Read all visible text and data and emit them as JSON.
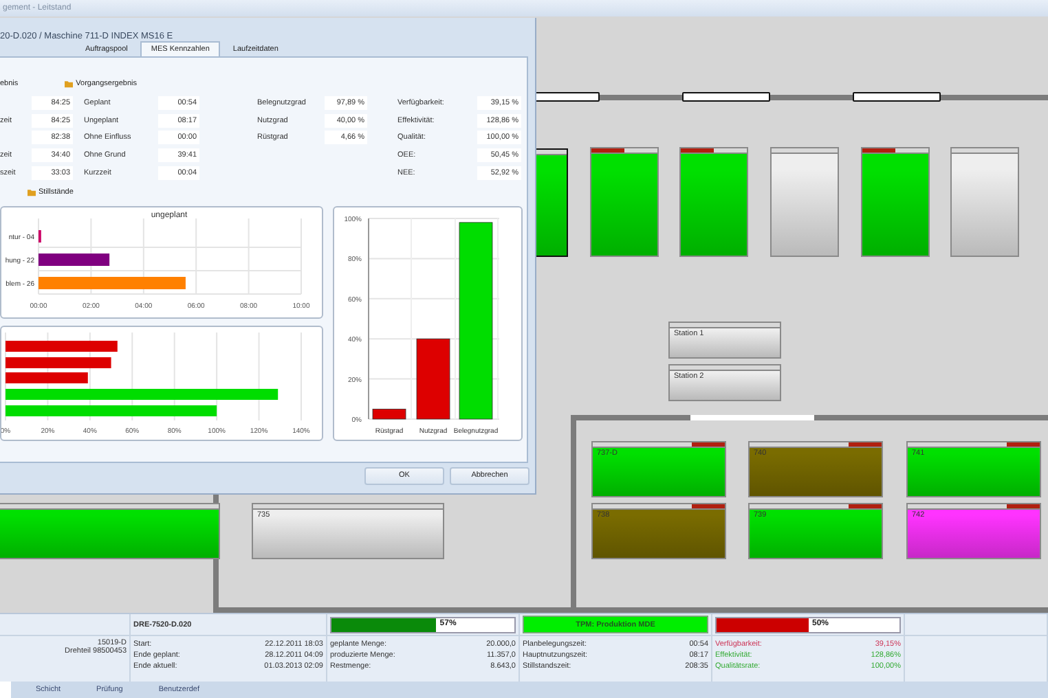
{
  "window": {
    "title": "gement - Leitstand"
  },
  "machines": [
    {
      "color": "#00e000",
      "alarm": false,
      "selected": true
    },
    {
      "color": "#00e000",
      "alarm": true,
      "selected": false
    },
    {
      "color": "#00e000",
      "alarm": true,
      "selected": false
    },
    {
      "color": "#eeeeee",
      "alarm": false,
      "selected": false
    },
    {
      "color": "#00e000",
      "alarm": true,
      "selected": false
    },
    {
      "color": "#eeeeee",
      "alarm": false,
      "selected": false
    },
    {
      "label": "Station 1",
      "color": "#eeeeee",
      "alarm": false,
      "selected": false
    },
    {
      "label": "Station 2",
      "color": "#eeeeee",
      "alarm": false,
      "selected": false
    },
    {
      "label": "737-D",
      "color": "#00e000",
      "alarm": true,
      "selected": false
    },
    {
      "label": "740",
      "color": "#7a6c00",
      "alarm": true,
      "selected": false
    },
    {
      "label": "741",
      "color": "#00e000",
      "alarm": true,
      "selected": false
    },
    {
      "color": "#00e000",
      "alarm": false,
      "selected": false
    },
    {
      "label": "735",
      "color": "#eeeeee",
      "alarm": false,
      "selected": false
    },
    {
      "label": "738",
      "color": "#7a6c00",
      "alarm": true,
      "selected": false
    },
    {
      "label": "739",
      "color": "#00e000",
      "alarm": true,
      "selected": false
    },
    {
      "label": "742",
      "color": "#ff33ff",
      "alarm": true,
      "selected": false
    }
  ],
  "dialog": {
    "title": "20-D.020 / Maschine 711-D INDEX MS16 E",
    "tabs": [
      {
        "label": "Auftragspool",
        "selected": false
      },
      {
        "label": "MES Kennzahlen",
        "selected": true
      },
      {
        "label": "Laufzeitdaten",
        "selected": false
      }
    ],
    "headers": [
      "ebnis",
      "Vorgangsergebnis"
    ],
    "metric_columns": [
      [
        {
          "value": "84:25"
        },
        {
          "label": "zeit",
          "value": "84:25"
        },
        {
          "value": "82:38"
        },
        {
          "label": "zeit",
          "value": "34:40"
        },
        {
          "label": "szeit",
          "value": "33:03"
        }
      ],
      [
        {
          "label": "Geplant",
          "value": "00:54"
        },
        {
          "label": "Ungeplant",
          "value": "08:17"
        },
        {
          "label": "Ohne Einfluss",
          "value": "00:00"
        },
        {
          "label": "Ohne Grund",
          "value": "39:41"
        },
        {
          "label": "Kurzzeit",
          "value": "00:04"
        }
      ],
      [
        {
          "label": "Belegnutzgrad",
          "value": "97,89 %"
        },
        {
          "label": "Nutzgrad",
          "value": "40,00 %"
        },
        {
          "label": "Rüstgrad",
          "value": "4,66 %"
        }
      ],
      [
        {
          "label": "Verfügbarkeit:",
          "value": "39,15 %"
        },
        {
          "label": "Effektivität:",
          "value": "128,86 %"
        },
        {
          "label": "Qualität:",
          "value": "100,00 %"
        },
        {
          "label": "OEE:",
          "value": "50,45 %"
        },
        {
          "label": "NEE:",
          "value": "52,92 %"
        }
      ]
    ],
    "stops_header": "Stillstände",
    "chart_stops": {
      "chart_data": {
        "type": "bar",
        "orientation": "horizontal",
        "stacked": true,
        "grid": true,
        "title": "ungeplant",
        "categories": [
          "ntur - 04",
          "hung - 22",
          "blem - 26"
        ],
        "series": [
          {
            "color": "#cc0066",
            "values": [
              0.1,
              null,
              null
            ]
          },
          {
            "color": "#800080",
            "values": [
              null,
              2.7,
              null
            ]
          },
          {
            "color": "#ff8000",
            "values": [
              null,
              null,
              5.6
            ]
          }
        ],
        "xlim": [
          0,
          10
        ],
        "xticks": [
          {
            "value": 0,
            "label": "00:00"
          },
          {
            "value": 2,
            "label": "02:00"
          },
          {
            "value": 4,
            "label": "04:00"
          },
          {
            "value": 6,
            "label": "06:00"
          },
          {
            "value": 8,
            "label": "08:00"
          },
          {
            "value": 10,
            "label": "10:00"
          }
        ]
      }
    },
    "chart_kpi": {
      "chart_data": {
        "type": "bar",
        "orientation": "horizontal",
        "stacked": true,
        "grid": true,
        "xlim": [
          0,
          140
        ],
        "series": [
          {
            "color": "#dd0000",
            "values": [
              53,
              50,
              39,
              null,
              null
            ]
          },
          {
            "color": "#00dd00",
            "values": [
              null,
              null,
              null,
              129,
              100
            ]
          }
        ],
        "xticks": [
          {
            "value": 0,
            "label": "0%"
          },
          {
            "value": 20,
            "label": "20%"
          },
          {
            "value": 40,
            "label": "40%"
          },
          {
            "value": 60,
            "label": "60%"
          },
          {
            "value": 80,
            "label": "80%"
          },
          {
            "value": 100,
            "label": "100%"
          },
          {
            "value": 120,
            "label": "120%"
          },
          {
            "value": 140,
            "label": "140%"
          }
        ]
      }
    },
    "chart_grades": {
      "chart_data": {
        "type": "bar",
        "orientation": "vertical",
        "stacked": true,
        "grid": true,
        "categories": [
          "Rüstgrad",
          "Nutzgrad",
          "Belegnutzgrad"
        ],
        "ylim": [
          0,
          100
        ],
        "series": [
          {
            "color": "#dd0000",
            "values": [
              5,
              40,
              null
            ]
          },
          {
            "color": "#00dd00",
            "values": [
              null,
              null,
              98
            ]
          }
        ],
        "yticks": [
          {
            "value": 0,
            "label": "0%"
          },
          {
            "value": 20,
            "label": "20%"
          },
          {
            "value": 40,
            "label": "40%"
          },
          {
            "value": 60,
            "label": "60%"
          },
          {
            "value": 80,
            "label": "80%"
          },
          {
            "value": 100,
            "label": "100%"
          }
        ]
      }
    },
    "buttons": [
      "OK",
      "Abbrechen"
    ]
  },
  "info": {
    "order": "DRE-7520-D.020",
    "article_no": "15019-D",
    "article": "Drehteil 98500453",
    "progress": [
      {
        "text": "57%",
        "level": 0.57,
        "color": "#0a8a0a"
      },
      {
        "text": "50%",
        "level": 0.5,
        "color": "#cc0000"
      }
    ],
    "status": "TPM: Produktion MDE",
    "dates": [
      {
        "label": "Start:",
        "value": "22.12.2011 18:03"
      },
      {
        "label": "Ende geplant:",
        "value": "28.12.2011 04:09"
      },
      {
        "label": "Ende aktuell:",
        "value": "01.03.2013 02:09"
      }
    ],
    "quantities": [
      {
        "label": "geplante Menge:",
        "value": "20.000,0"
      },
      {
        "label": "produzierte Menge:",
        "value": "11.357,0"
      },
      {
        "label": "Restmenge:",
        "value": "8.643,0"
      }
    ],
    "times": [
      {
        "label": "Planbelegungszeit:",
        "value": "00:54"
      },
      {
        "label": "Hauptnutzungszeit:",
        "value": "08:17"
      },
      {
        "label": "Stillstandszeit:",
        "value": "208:35"
      }
    ],
    "kpis": [
      {
        "label": "Verfügbarkeit:",
        "value": "39,15%",
        "color": "#cc3355"
      },
      {
        "label": "Effektivität:",
        "value": "128,86%",
        "color": "#33aa33"
      },
      {
        "label": "Qualitätsrate:",
        "value": "100,00%",
        "color": "#33aa33"
      }
    ]
  },
  "bottom_tabs": [
    {
      "selected": true
    },
    {
      "label": "Schicht",
      "selected": false
    },
    {
      "label": "Prüfung",
      "selected": false
    },
    {
      "label": "Benutzerdef",
      "selected": false
    }
  ]
}
